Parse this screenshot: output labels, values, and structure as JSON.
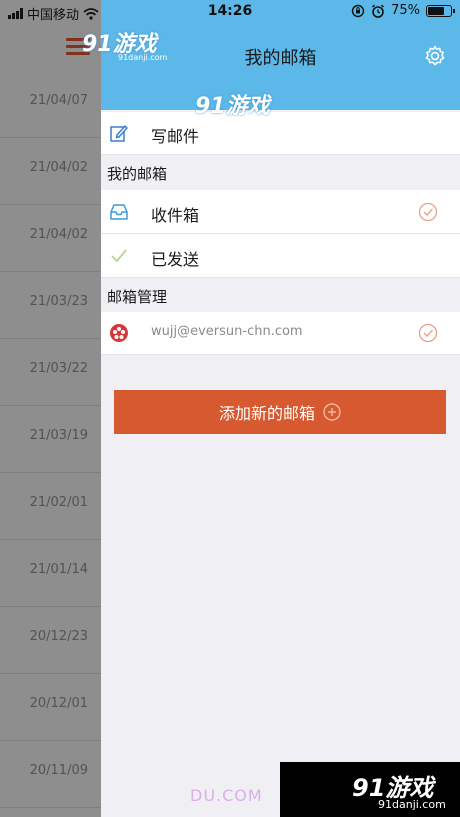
{
  "status_bar": {
    "carrier": "中国移动",
    "time": "14:26",
    "battery": "75%",
    "battery_level": 0.75
  },
  "background_list": {
    "dates": [
      "21/04/07",
      "21/04/02",
      "21/04/02",
      "21/03/23",
      "21/03/22",
      "21/03/19",
      "21/02/01",
      "21/01/14",
      "20/12/23",
      "20/12/01",
      "20/11/09"
    ]
  },
  "drawer": {
    "title": "我的邮箱",
    "compose_label": "写邮件",
    "section_mailbox": "我的邮箱",
    "inbox_label": "收件箱",
    "sent_label": "已发送",
    "section_manage": "邮箱管理",
    "account_email": "wujj@eversun-chn.com",
    "add_button_label": "添加新的邮箱"
  },
  "watermarks": {
    "logo_text": "91游戏",
    "logo_url": "91danji.com",
    "faint_text": "DU.COM"
  },
  "colors": {
    "header_blue": "#5bb8e8",
    "accent_orange": "#d75930"
  }
}
